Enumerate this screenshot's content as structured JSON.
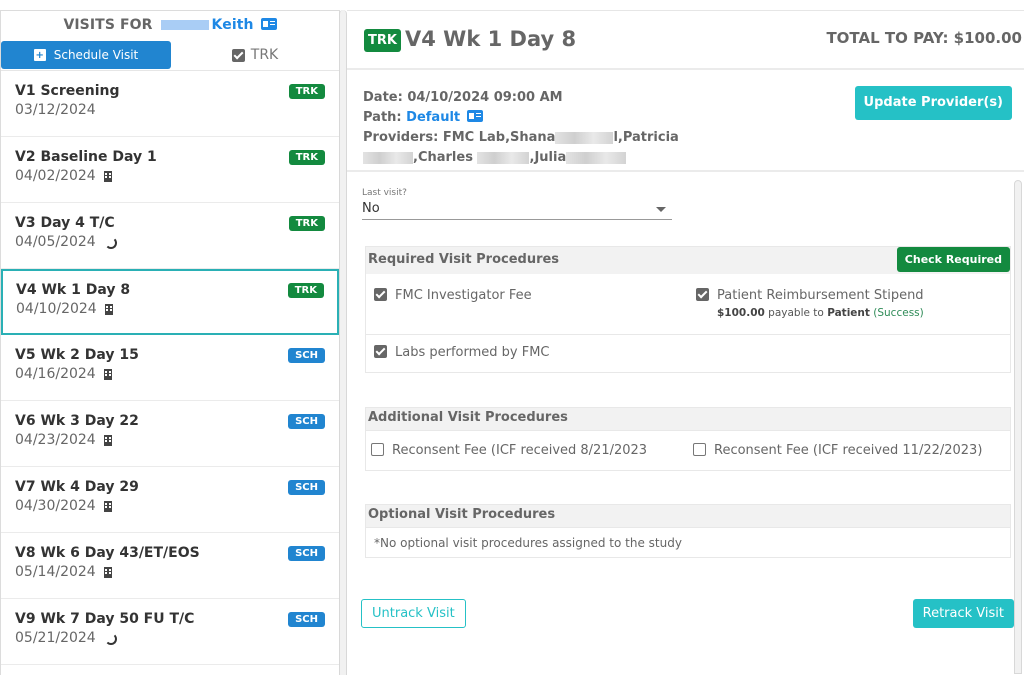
{
  "sidebar": {
    "title_prefix": "VISITS FOR",
    "patient_name": "Keith",
    "schedule_button": "Schedule Visit",
    "trk_filter_label": "TRK",
    "visits": [
      {
        "name": "V1 Screening",
        "date": "03/12/2024",
        "icon": "none",
        "status": "TRK"
      },
      {
        "name": "V2 Baseline Day 1",
        "date": "04/02/2024",
        "icon": "building-icon",
        "status": "TRK"
      },
      {
        "name": "V3 Day 4 T/C",
        "date": "04/05/2024",
        "icon": "phone-icon",
        "status": "TRK"
      },
      {
        "name": "V4 Wk 1 Day 8",
        "date": "04/10/2024",
        "icon": "building-icon",
        "status": "TRK",
        "active": true
      },
      {
        "name": "V5 Wk 2 Day 15",
        "date": "04/16/2024",
        "icon": "building-icon",
        "status": "SCH"
      },
      {
        "name": "V6 Wk 3 Day 22",
        "date": "04/23/2024",
        "icon": "building-icon",
        "status": "SCH"
      },
      {
        "name": "V7 Wk 4 Day 29",
        "date": "04/30/2024",
        "icon": "building-icon",
        "status": "SCH"
      },
      {
        "name": "V8 Wk 6 Day 43/ET/EOS",
        "date": "05/14/2024",
        "icon": "building-icon",
        "status": "SCH"
      },
      {
        "name": "V9 Wk 7 Day 50 FU T/C",
        "date": "05/21/2024",
        "icon": "phone-icon",
        "status": "SCH"
      }
    ]
  },
  "detail": {
    "status_badge": "TRK",
    "title": "V4 Wk 1 Day 8",
    "total_to_pay": "TOTAL TO PAY: $100.00",
    "date_line": "Date: 04/10/2024 09:00 AM",
    "path_label": "Path:",
    "path_value": "Default",
    "providers_label": "Providers:",
    "providers": [
      "FMC Lab",
      "Shana",
      "Patricia",
      "Charles",
      "Julia"
    ],
    "update_providers_button": "Update Provider(s)",
    "last_visit": {
      "label": "Last visit?",
      "value": "No"
    },
    "required": {
      "title": "Required Visit Procedures",
      "check_button": "Check Required",
      "items": [
        {
          "label": "FMC Investigator Fee",
          "checked": true
        },
        {
          "label": "Patient Reimbursement Stipend",
          "checked": true,
          "amount": "$100.00",
          "payable_text": "payable to",
          "payee": "Patient",
          "result": "(Success)"
        },
        {
          "label": "Labs performed by FMC",
          "checked": true
        }
      ]
    },
    "additional": {
      "title": "Additional Visit Procedures",
      "items": [
        {
          "label": "Reconsent Fee (ICF received 8/21/2023",
          "checked": false
        },
        {
          "label": "Reconsent Fee (ICF received 11/22/2023)",
          "checked": false
        }
      ]
    },
    "optional": {
      "title": "Optional Visit Procedures",
      "note": "*No optional visit procedures assigned to the study"
    },
    "untrack_button": "Untrack Visit",
    "retrack_button": "Retrack Visit"
  },
  "colors": {
    "trk_green": "#138a3f",
    "sch_blue": "#2185d0",
    "teal": "#25c1c6",
    "link_blue": "#1e88e5"
  }
}
